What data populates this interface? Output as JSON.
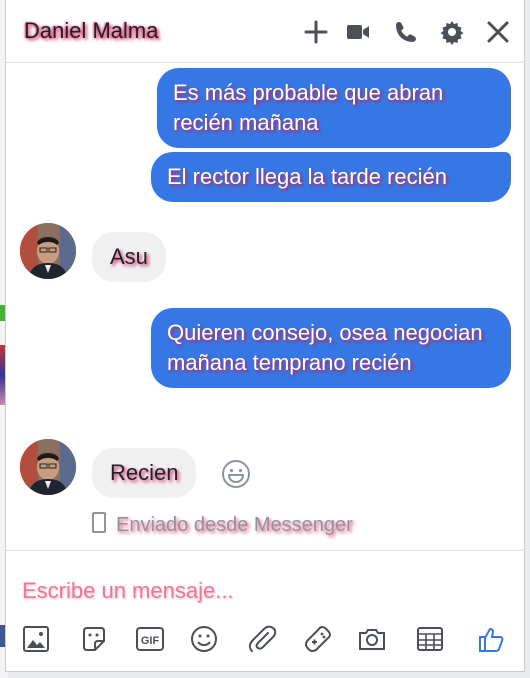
{
  "header": {
    "title": "Daniel Malma",
    "icons": [
      "plus-icon",
      "video-icon",
      "phone-icon",
      "gear-icon",
      "close-icon"
    ]
  },
  "messages": [
    {
      "side": "out",
      "text": "Es más probable que abran recién mañana"
    },
    {
      "side": "out",
      "text": "El rector llega la tarde recién"
    },
    {
      "side": "in",
      "text": "Asu"
    },
    {
      "side": "out",
      "text": "Quieren consejo, osea negocian mañana temprano recién"
    },
    {
      "side": "in",
      "text": "Recien"
    }
  ],
  "status": {
    "text": "Enviado desde Messenger"
  },
  "composer": {
    "placeholder": "Escribe un mensaje..."
  },
  "toolbar": {
    "items": [
      "photo-icon",
      "sticker-icon",
      "gif-icon",
      "emoji-icon",
      "attachment-icon",
      "game-icon",
      "camera-icon",
      "plan-icon",
      "like-icon"
    ],
    "gif_label": "GIF"
  },
  "colors": {
    "outgoing": "#3578e5",
    "incoming": "#f1f0f0",
    "like": "#3578e5"
  }
}
